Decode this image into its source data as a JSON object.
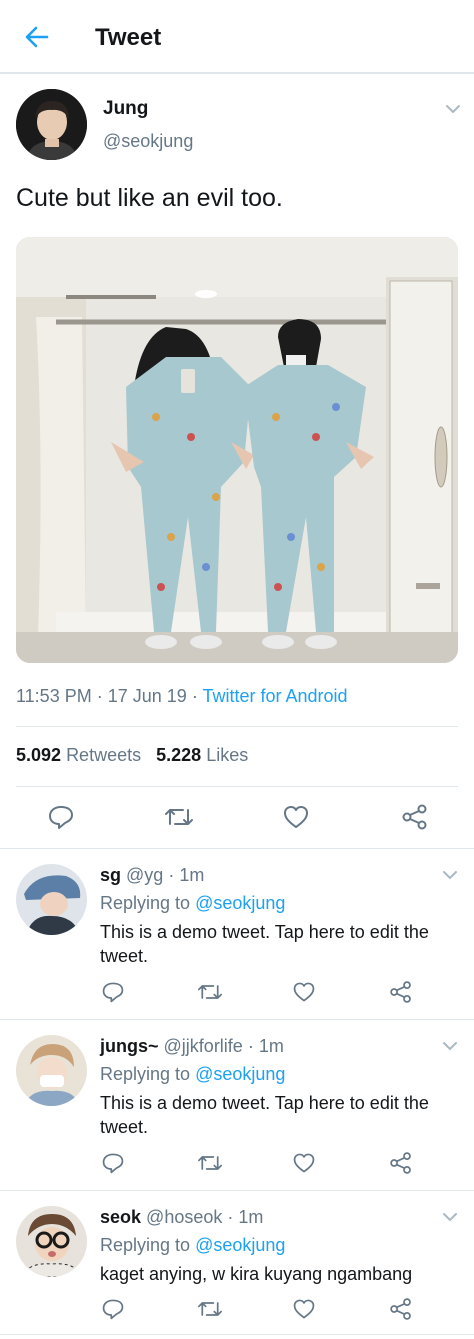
{
  "header": {
    "title": "Tweet",
    "back_icon": "back-arrow-icon"
  },
  "tweet": {
    "author_name": "Jung",
    "author_handle": "@seokjung",
    "text": "Cute but like an evil too.",
    "time": "11:53 PM",
    "date": "17 Jun 19",
    "source": "Twitter for Android",
    "retweets_count": "5.092",
    "retweets_label": "Retweets",
    "likes_count": "5.228",
    "likes_label": "Likes"
  },
  "replies": [
    {
      "name": "sg",
      "handle": "@yg",
      "time": "1m",
      "replying_prefix": "Replying to",
      "replying_to": "@seokjung",
      "text": "This is a demo tweet. Tap here to edit the tweet."
    },
    {
      "name": "jungs~",
      "handle": "@jjkforlife",
      "time": "1m",
      "replying_prefix": "Replying to",
      "replying_to": "@seokjung",
      "text": "This is a demo tweet. Tap here to edit the tweet."
    },
    {
      "name": "seok",
      "handle": "@hoseok",
      "time": "1m",
      "replying_prefix": "Replying to",
      "replying_to": "@seokjung",
      "text": "kaget anying, w kira kuyang ngambang"
    }
  ],
  "colors": {
    "accent": "#1da1f2",
    "secondary_text": "#657786",
    "divider": "#e1e8ed",
    "icon": "#657786"
  }
}
